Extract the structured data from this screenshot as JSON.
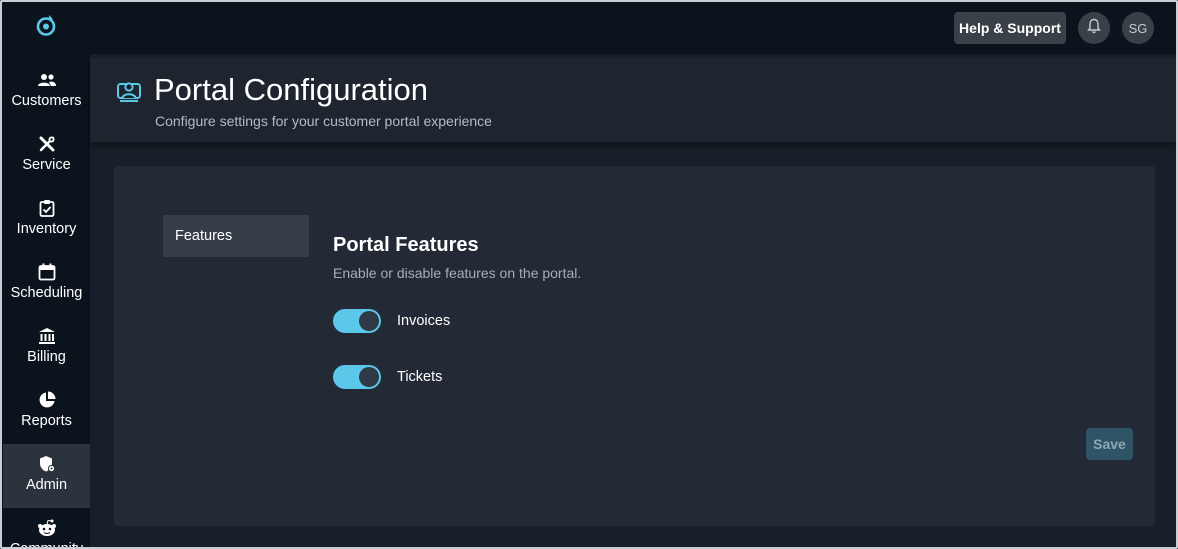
{
  "sidebar": {
    "items": [
      {
        "label": "Customers",
        "icon": "people-icon"
      },
      {
        "label": "Service",
        "icon": "tools-icon"
      },
      {
        "label": "Inventory",
        "icon": "clipboard-check-icon"
      },
      {
        "label": "Scheduling",
        "icon": "calendar-icon"
      },
      {
        "label": "Billing",
        "icon": "bank-icon"
      },
      {
        "label": "Reports",
        "icon": "pie-chart-icon"
      },
      {
        "label": "Admin",
        "icon": "shield-gear-icon",
        "active": true
      },
      {
        "label": "Community",
        "icon": "reddit-alien-icon"
      }
    ]
  },
  "topbar": {
    "help_label": "Help & Support",
    "avatar_initials": "SG"
  },
  "header": {
    "title": "Portal Configuration",
    "subtitle": "Configure settings for your customer portal experience"
  },
  "tabs": {
    "features_label": "Features"
  },
  "features": {
    "title": "Portal Features",
    "description": "Enable or disable features on the portal.",
    "toggles": [
      {
        "label": "Invoices",
        "enabled": true
      },
      {
        "label": "Tickets",
        "enabled": true
      }
    ]
  },
  "actions": {
    "save_label": "Save"
  },
  "colors": {
    "accent": "#5bc8ea",
    "background": "#0b141d",
    "card": "#232a35"
  }
}
